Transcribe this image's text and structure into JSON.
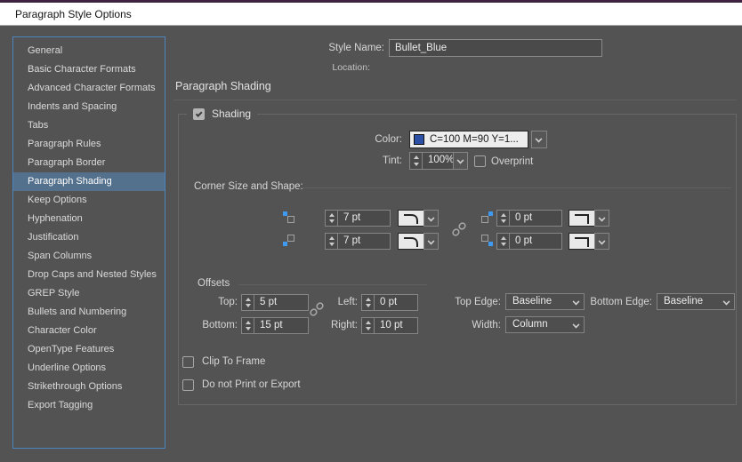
{
  "window": {
    "title": "Paragraph Style Options"
  },
  "sidebar": {
    "items": [
      {
        "label": "General",
        "selected": false
      },
      {
        "label": "Basic Character Formats",
        "selected": false
      },
      {
        "label": "Advanced Character Formats",
        "selected": false
      },
      {
        "label": "Indents and Spacing",
        "selected": false
      },
      {
        "label": "Tabs",
        "selected": false
      },
      {
        "label": "Paragraph Rules",
        "selected": false
      },
      {
        "label": "Paragraph Border",
        "selected": false
      },
      {
        "label": "Paragraph Shading",
        "selected": true
      },
      {
        "label": "Keep Options",
        "selected": false
      },
      {
        "label": "Hyphenation",
        "selected": false
      },
      {
        "label": "Justification",
        "selected": false
      },
      {
        "label": "Span Columns",
        "selected": false
      },
      {
        "label": "Drop Caps and Nested Styles",
        "selected": false
      },
      {
        "label": "GREP Style",
        "selected": false
      },
      {
        "label": "Bullets and Numbering",
        "selected": false
      },
      {
        "label": "Character Color",
        "selected": false
      },
      {
        "label": "OpenType Features",
        "selected": false
      },
      {
        "label": "Underline Options",
        "selected": false
      },
      {
        "label": "Strikethrough Options",
        "selected": false
      },
      {
        "label": "Export Tagging",
        "selected": false
      }
    ]
  },
  "header": {
    "style_name_label": "Style Name:",
    "style_name_value": "Bullet_Blue",
    "location_label": "Location:"
  },
  "panel": {
    "title": "Paragraph Shading"
  },
  "shading": {
    "group_label": "Shading",
    "group_checked": true,
    "color_label": "Color:",
    "color_value": "C=100 M=90 Y=1...",
    "tint_label": "Tint:",
    "tint_value": "100%",
    "overprint_label": "Overprint",
    "overprint_checked": false,
    "corner": {
      "title": "Corner Size and Shape:",
      "top_left_value": "7 pt",
      "bottom_left_value": "7 pt",
      "top_right_value": "0 pt",
      "bottom_right_value": "0 pt",
      "left_shape": "rounded",
      "right_shape": "square"
    },
    "offsets": {
      "title": "Offsets",
      "top_label": "Top:",
      "top_value": "5 pt",
      "bottom_label": "Bottom:",
      "bottom_value": "15 pt",
      "left_label": "Left:",
      "left_value": "0 pt",
      "right_label": "Right:",
      "right_value": "10 pt"
    },
    "edges": {
      "top_edge_label": "Top Edge:",
      "top_edge_value": "Baseline",
      "bottom_edge_label": "Bottom Edge:",
      "bottom_edge_value": "Baseline",
      "width_label": "Width:",
      "width_value": "Column"
    },
    "clip_label": "Clip To Frame",
    "clip_checked": false,
    "noprint_label": "Do not Print or Export",
    "noprint_checked": false
  },
  "colors": {
    "titlebar_accent": "#3f2140",
    "dialog_bg": "#535353",
    "sidebar_focus_border": "#4c84c1",
    "selected_item_bg": "#53708c",
    "swatch_blue": "#2b50a5",
    "corner_icon_blue": "#3f9bf0"
  }
}
